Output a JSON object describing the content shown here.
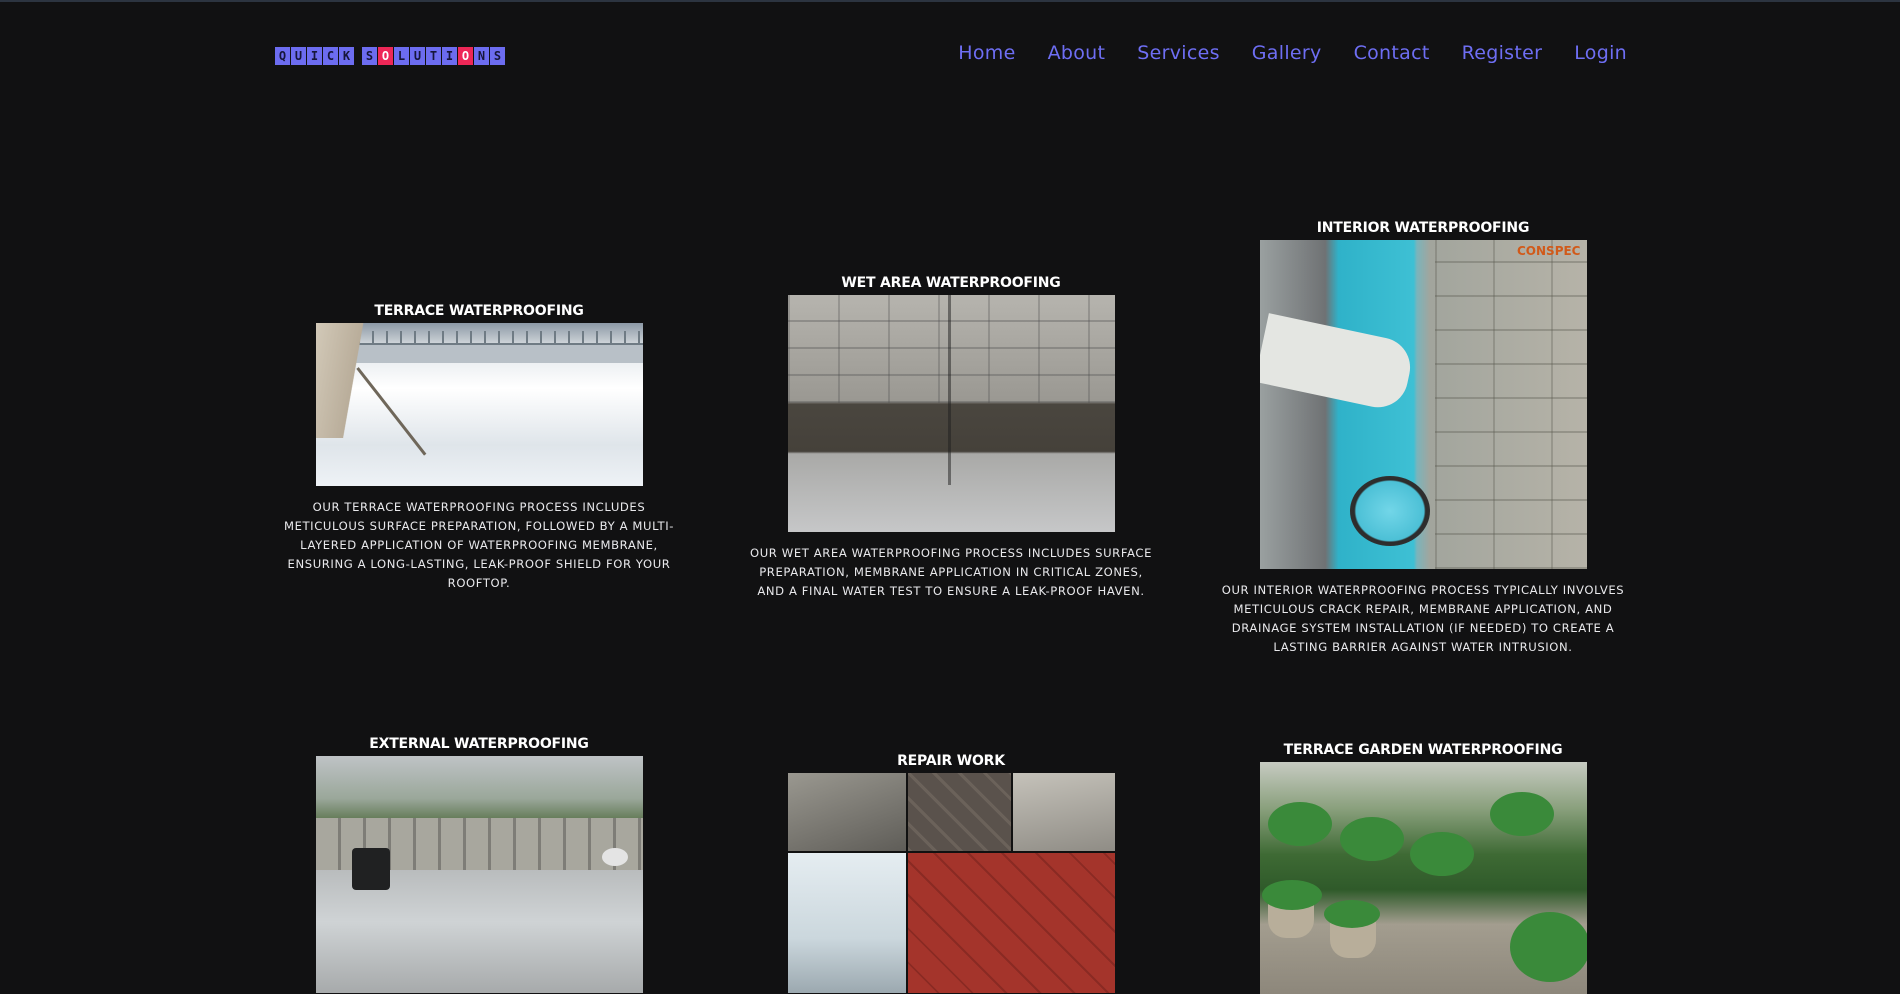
{
  "logo": {
    "letters": [
      {
        "ch": "Q",
        "red": false
      },
      {
        "ch": "U",
        "red": false
      },
      {
        "ch": "I",
        "red": false
      },
      {
        "ch": "C",
        "red": false
      },
      {
        "ch": "K",
        "red": false
      },
      {
        "ch": " ",
        "red": false
      },
      {
        "ch": "S",
        "red": false
      },
      {
        "ch": "O",
        "red": true
      },
      {
        "ch": "L",
        "red": false
      },
      {
        "ch": "U",
        "red": false
      },
      {
        "ch": "T",
        "red": false
      },
      {
        "ch": "I",
        "red": false
      },
      {
        "ch": "O",
        "red": true
      },
      {
        "ch": "N",
        "red": false
      },
      {
        "ch": "S",
        "red": false
      }
    ],
    "text": "QUICK SOLUTIONS",
    "colors": {
      "tile": "#6c6cf0",
      "highlight": "#ee2757"
    }
  },
  "nav": {
    "items": [
      "Home",
      "About",
      "Services",
      "Gallery",
      "Contact",
      "Register",
      "Login"
    ],
    "color": "#6e6ef3"
  },
  "services": [
    {
      "title": "TERRACE WATERPROOFING",
      "image": "terrace-photo",
      "description": "OUR TERRACE WATERPROOFING PROCESS INCLUDES METICULOUS SURFACE PREPARATION, FOLLOWED BY A MULTI-LAYERED APPLICATION OF WATERPROOFING MEMBRANE, ENSURING A LONG-LASTING, LEAK-PROOF SHIELD FOR YOUR ROOFTOP."
    },
    {
      "title": "WET AREA WATERPROOFING",
      "image": "wet-area-photo",
      "description": "OUR WET AREA WATERPROOFING PROCESS INCLUDES SURFACE PREPARATION, MEMBRANE APPLICATION IN CRITICAL ZONES, AND A FINAL WATER TEST TO ENSURE A LEAK-PROOF HAVEN."
    },
    {
      "title": "INTERIOR WATERPROOFING",
      "image": "interior-photo",
      "brand": "CONSPEC",
      "description": "OUR INTERIOR WATERPROOFING PROCESS TYPICALLY INVOLVES METICULOUS CRACK REPAIR, MEMBRANE APPLICATION, AND DRAINAGE SYSTEM INSTALLATION (IF NEEDED) TO CREATE A LASTING BARRIER AGAINST WATER INTRUSION."
    },
    {
      "title": "EXTERNAL WATERPROOFING",
      "image": "external-photo"
    },
    {
      "title": "REPAIR WORK",
      "image": "repair-collage-photo"
    },
    {
      "title": "TERRACE GARDEN WATERPROOFING",
      "image": "terrace-garden-photo"
    }
  ]
}
